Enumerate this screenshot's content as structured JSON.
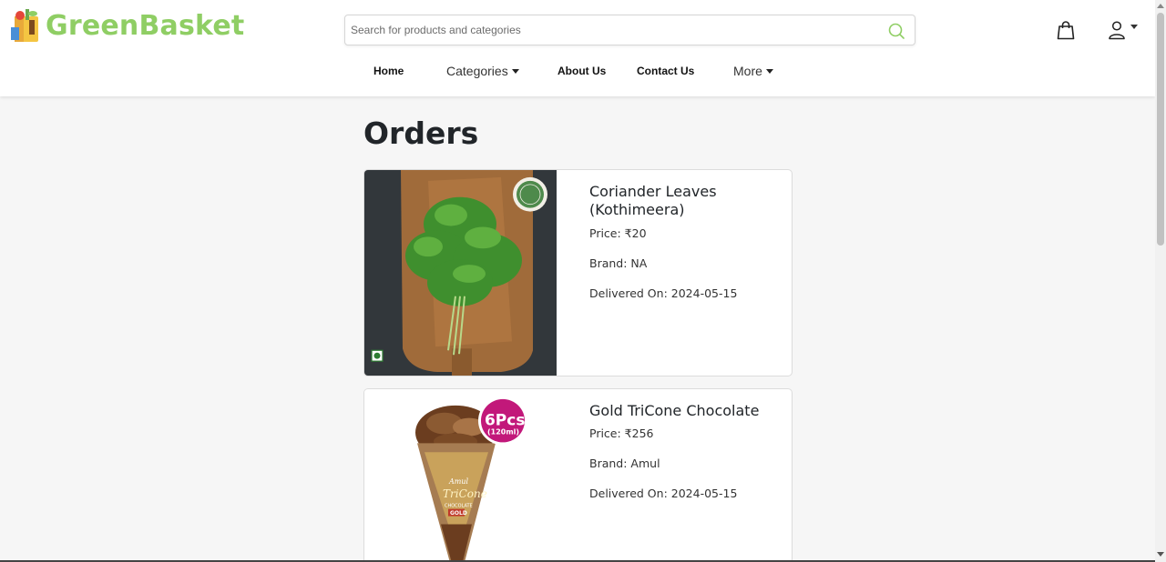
{
  "header": {
    "brand": "GreenBasket",
    "search": {
      "placeholder": "Search for products and categories",
      "value": ""
    },
    "nav": [
      {
        "label": "Home",
        "dropdown": false
      },
      {
        "label": "Categories",
        "dropdown": true
      },
      {
        "label": "About Us",
        "dropdown": false
      },
      {
        "label": "Contact Us",
        "dropdown": false
      },
      {
        "label": "More",
        "dropdown": true
      }
    ],
    "icons": {
      "search": "search-icon",
      "cart": "shopping-bag-icon",
      "user": "user-icon"
    }
  },
  "main": {
    "title": "Orders",
    "orders": [
      {
        "name": "Coriander Leaves (Kothimeera)",
        "price": "Price: ₹20",
        "brand": "Brand: NA",
        "delivered": "Delivered On: 2024-05-15",
        "image": "coriander-leaves-photo"
      },
      {
        "name": "Gold TriCone Chocolate",
        "price": "Price: ₹256",
        "brand": "Brand: Amul",
        "delivered": "Delivered On: 2024-05-15",
        "image": "tricone-ice-cream-photo",
        "badge": {
          "count": "6Pcs",
          "size": "(120ml)"
        },
        "cone_text": {
          "brand": "Amul",
          "product": "TriCone",
          "flavor": "CHOCOLATE",
          "variant": "GOLD"
        }
      }
    ]
  },
  "colors": {
    "brand_green": "#8fce64",
    "search_icon": "#8fce64",
    "badge_pink": "#c2187a"
  }
}
